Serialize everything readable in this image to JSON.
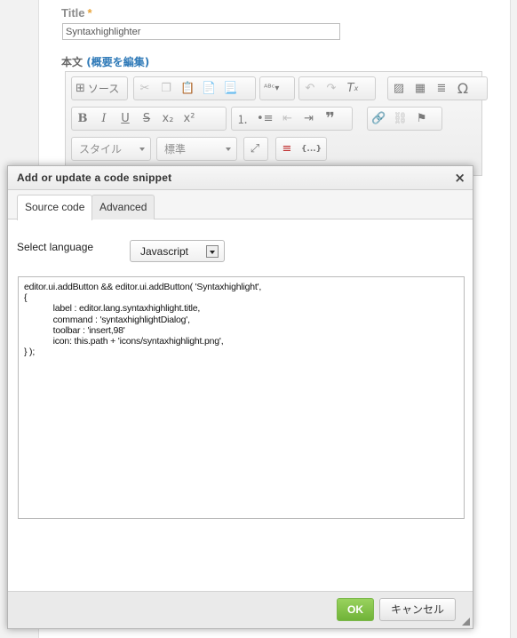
{
  "page": {
    "title_label": "Title",
    "required_mark": "*",
    "title_value": "Syntaxhighlighter",
    "body_label": "本文",
    "body_label_link": "概要を編集",
    "body_label_open": "(",
    "body_label_close": ")"
  },
  "editor_toolbar": {
    "source_label": "ソース",
    "style_combo": "スタイル",
    "format_combo": "標準",
    "buttons": {
      "bold": "B",
      "italic": "I",
      "underline": "U",
      "strike": "S",
      "subscript": "x₂",
      "superscript": "x²",
      "omega": "Ω",
      "codesnippet": "{...}"
    }
  },
  "dialog": {
    "title": "Add or update a code snippet",
    "close": "×",
    "tabs": [
      {
        "label": "Source code",
        "active": true
      },
      {
        "label": "Advanced",
        "active": false
      }
    ],
    "select_language_label": "Select language",
    "language_value": "Javascript",
    "code_lines": [
      "editor.ui.addButton && editor.ui.addButton( 'Syntaxhighlight',",
      "{",
      "            label : editor.lang.syntaxhighlight.title,",
      "            command : 'syntaxhighlightDialog',",
      "            toolbar : 'insert,98'",
      "            icon: this.path + 'icons/syntaxhighlight.png',",
      "} );"
    ],
    "ok_label": "OK",
    "cancel_label": "キャンセル"
  },
  "colors": {
    "accent_green": "#7ab74a",
    "link_blue": "#2f7ab8",
    "required_orange": "#e8a33a"
  }
}
